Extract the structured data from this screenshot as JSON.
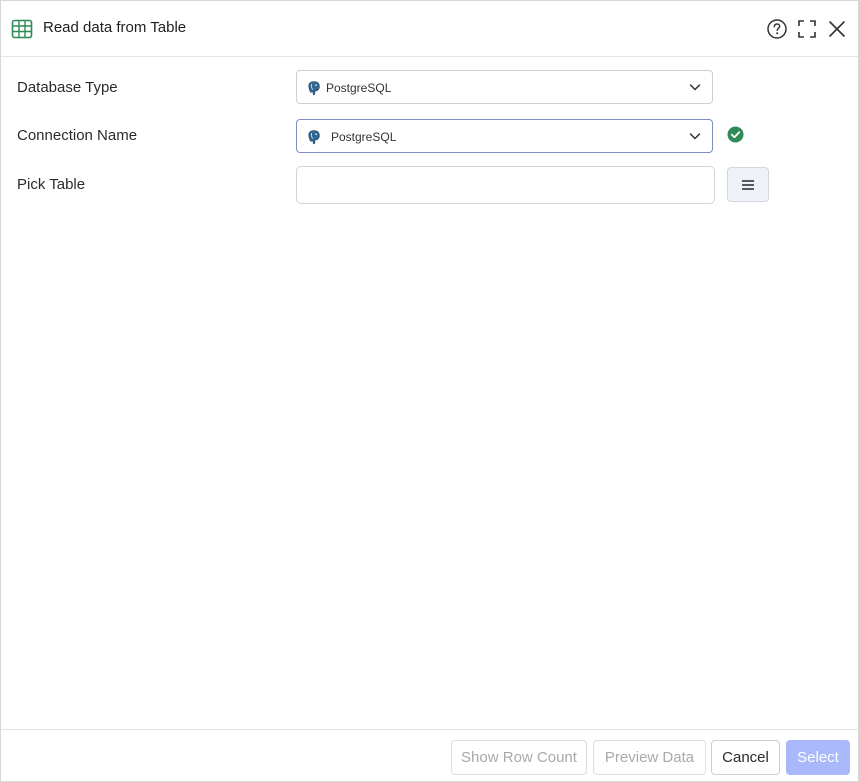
{
  "header": {
    "title": "Read data from Table",
    "icons": {
      "title": "table-icon",
      "help": "help-circle-icon",
      "maximize": "maximize-icon",
      "close": "close-icon"
    }
  },
  "form": {
    "database_type": {
      "label": "Database Type",
      "value": "PostgreSQL",
      "icon": "postgresql-icon"
    },
    "connection_name": {
      "label": "Connection Name",
      "value": "PostgreSQL",
      "icon": "postgresql-icon",
      "status_icon": "check-circle-icon"
    },
    "pick_table": {
      "label": "Pick Table",
      "value": "",
      "button_icon": "list-icon"
    }
  },
  "footer": {
    "show_row_count": "Show Row Count",
    "preview_data": "Preview Data",
    "cancel": "Cancel",
    "select": "Select"
  },
  "colors": {
    "accent_green": "#2e8b57",
    "primary_disabled": "#a9b8fb",
    "focus_border": "#7a8fbf"
  }
}
